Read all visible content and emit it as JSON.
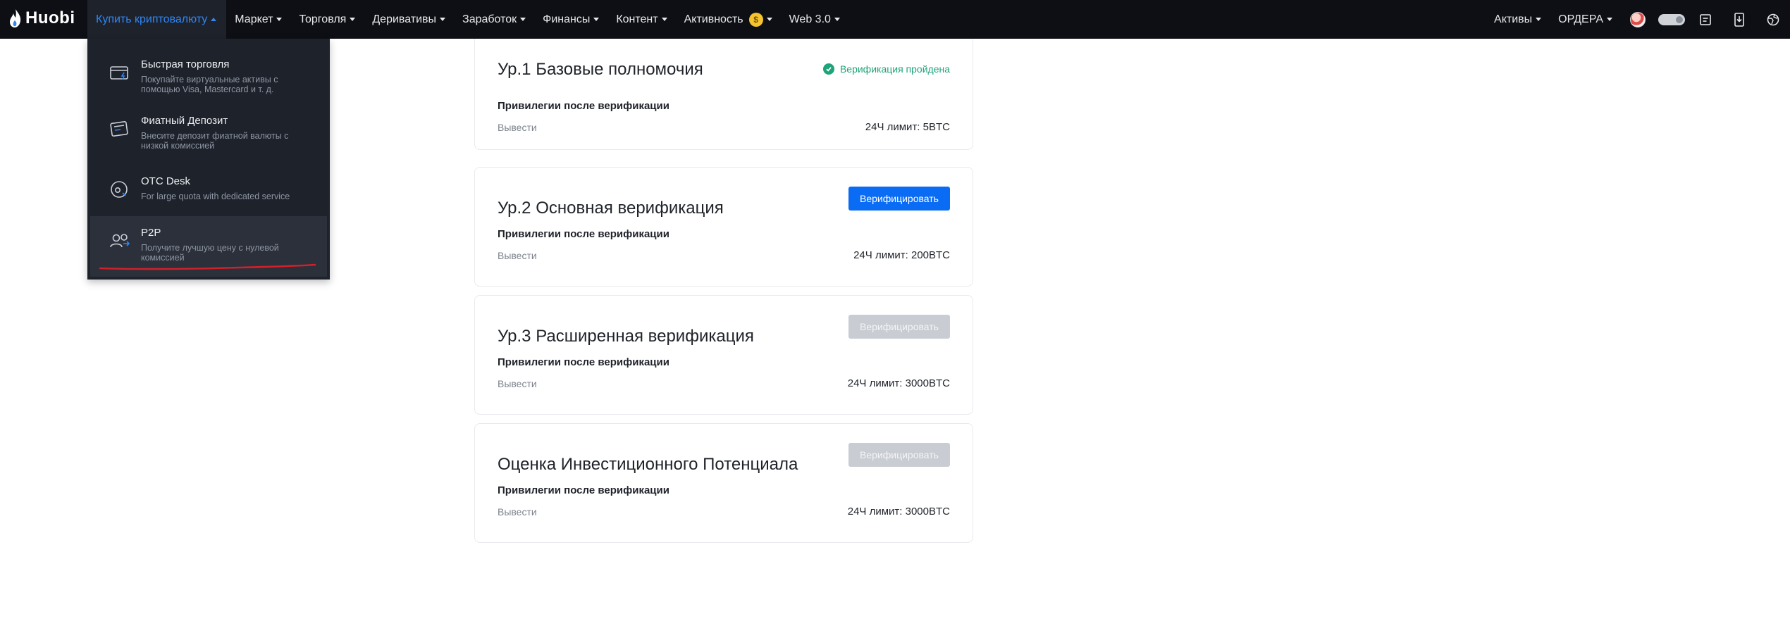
{
  "brand": {
    "name": "Huobi"
  },
  "nav": {
    "items": [
      {
        "label": "Купить криптовалюту",
        "active": true
      },
      {
        "label": "Маркет"
      },
      {
        "label": "Торговля"
      },
      {
        "label": "Деривативы"
      },
      {
        "label": "Заработок"
      },
      {
        "label": "Финансы"
      },
      {
        "label": "Контент"
      },
      {
        "label": "Активность"
      },
      {
        "label": "Web 3.0"
      }
    ],
    "activity_badge": "$",
    "right": {
      "assets": "Активы",
      "orders": "ОРДЕРА"
    }
  },
  "dropdown": {
    "items": [
      {
        "title": "Быстрая торговля",
        "desc": "Покупайте виртуальные активы с помощью Visa, Mastercard и т. д.",
        "icon": "card-lightning-icon"
      },
      {
        "title": "Фиатный Депозит",
        "desc": "Внесите депозит фиатной валюты с низкой комиссией",
        "icon": "deposit-card-icon"
      },
      {
        "title": "OTC Desk",
        "desc": "For large quota with dedicated service",
        "icon": "otc-icon"
      },
      {
        "title": "P2P",
        "desc": "Получите лучшую цену с нулевой комиссией",
        "icon": "p2p-users-icon"
      }
    ]
  },
  "levels": [
    {
      "title": "Ур.1 Базовые полномочия",
      "status": "Верификация пройдена",
      "subtitle": "Привилегии после верификации",
      "label": "Вывести",
      "limit": "24Ч лимит: 5BTC"
    },
    {
      "title": "Ур.2 Основная верификация",
      "button": "Верифицировать",
      "subtitle": "Привилегии после верификации",
      "label": "Вывести",
      "limit": "24Ч лимит: 200BTC"
    },
    {
      "title": "Ур.3 Расширенная верификация",
      "button": "Верифицировать",
      "subtitle": "Привилегии после верификации",
      "label": "Вывести",
      "limit": "24Ч лимит: 3000BTC"
    },
    {
      "title": "Оценка Инвестиционного Потенциала",
      "button": "Верифицировать",
      "subtitle": "Привилегии после верификации",
      "label": "Вывести",
      "limit": "24Ч лимит: 3000BTC"
    }
  ],
  "colors": {
    "accent": "#0a6cf5",
    "success": "#1fa37a",
    "nav_bg": "#0d0f14",
    "dropdown_bg": "#1e222b",
    "annotation": "#d0202a"
  }
}
